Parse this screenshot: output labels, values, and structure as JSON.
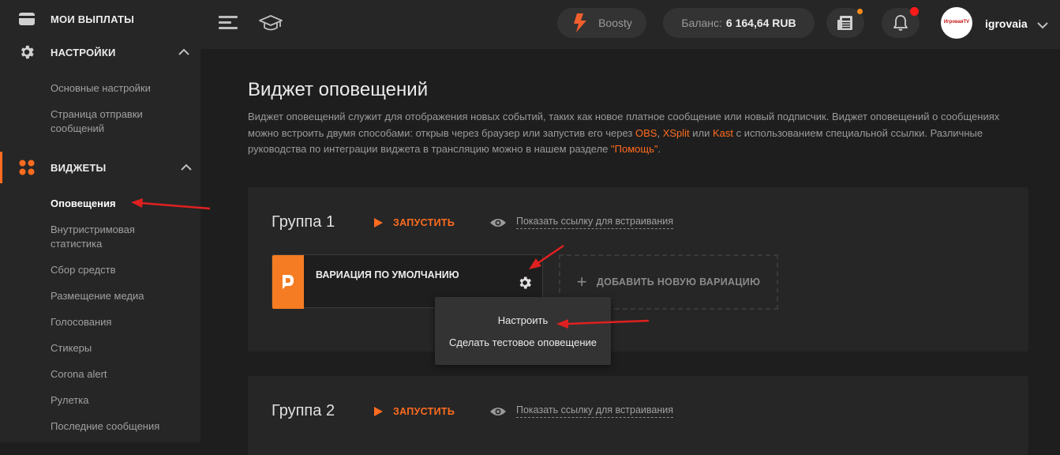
{
  "sidebar": {
    "payouts": {
      "label": "МОИ ВЫПЛАТЫ"
    },
    "settings": {
      "label": "НАСТРОЙКИ",
      "items": [
        "Основные настройки",
        "Страница отправки сообщений"
      ]
    },
    "widgets": {
      "label": "ВИДЖЕТЫ",
      "items": [
        "Оповещения",
        "Внутристримовая статистика",
        "Сбор средств",
        "Размещение медиа",
        "Голосования",
        "Стикеры",
        "Corona alert",
        "Рулетка",
        "Последние сообщения"
      ]
    }
  },
  "topbar": {
    "boosty_label": "Boosty",
    "balance_label": "Баланс:",
    "balance_value": "6 164,64 RUB",
    "avatar_text": "ИгроваяTV",
    "username": "igrovaia"
  },
  "main": {
    "title": "Виджет оповещений",
    "desc_1": "Виджет оповещений служит для отображения новых событий, таких как новое платное сообщение или новый подписчик. Виджет оповещений о сообщениях можно встроить двумя способами: открыв через браузер или запустив его через ",
    "obs": "OBS",
    "comma": ", ",
    "xsplit": "XSplit",
    "or": " или ",
    "kast": "Kast",
    "desc_2": " с использованием специальной ссылки. Различные руководства по интеграции виджета в трансляцию можно в нашем разделе ",
    "help": "\"Помощь\"",
    "period": "."
  },
  "groups": [
    {
      "title": "Группа 1",
      "run_label": "ЗАПУСТИТЬ",
      "show_link": "Показать ссылку для встраивания",
      "variation_title": "ВАРИАЦИЯ ПО УМОЛЧАНИЮ",
      "add_variation": "ДОБАВИТЬ НОВУЮ ВАРИАЦИЮ"
    },
    {
      "title": "Группа 2",
      "run_label": "ЗАПУСТИТЬ",
      "show_link": "Показать ссылку для встраивания"
    }
  ],
  "dropdown": {
    "items": [
      "Настроить",
      "Сделать тестовое оповещение"
    ]
  },
  "colors": {
    "accent": "#ff6c1f",
    "arrow": "#e02020",
    "notification_dot": "#ff1a1a"
  },
  "icons": [
    "wallet-icon",
    "gear-icon",
    "widgets-icon",
    "chevron-up-icon",
    "menu-icon",
    "graduation-cap-icon",
    "boosty-logo-icon",
    "news-icon",
    "bell-icon",
    "chevron-down-icon",
    "play-icon",
    "eye-icon",
    "plus-icon",
    "donationalerts-icon"
  ]
}
